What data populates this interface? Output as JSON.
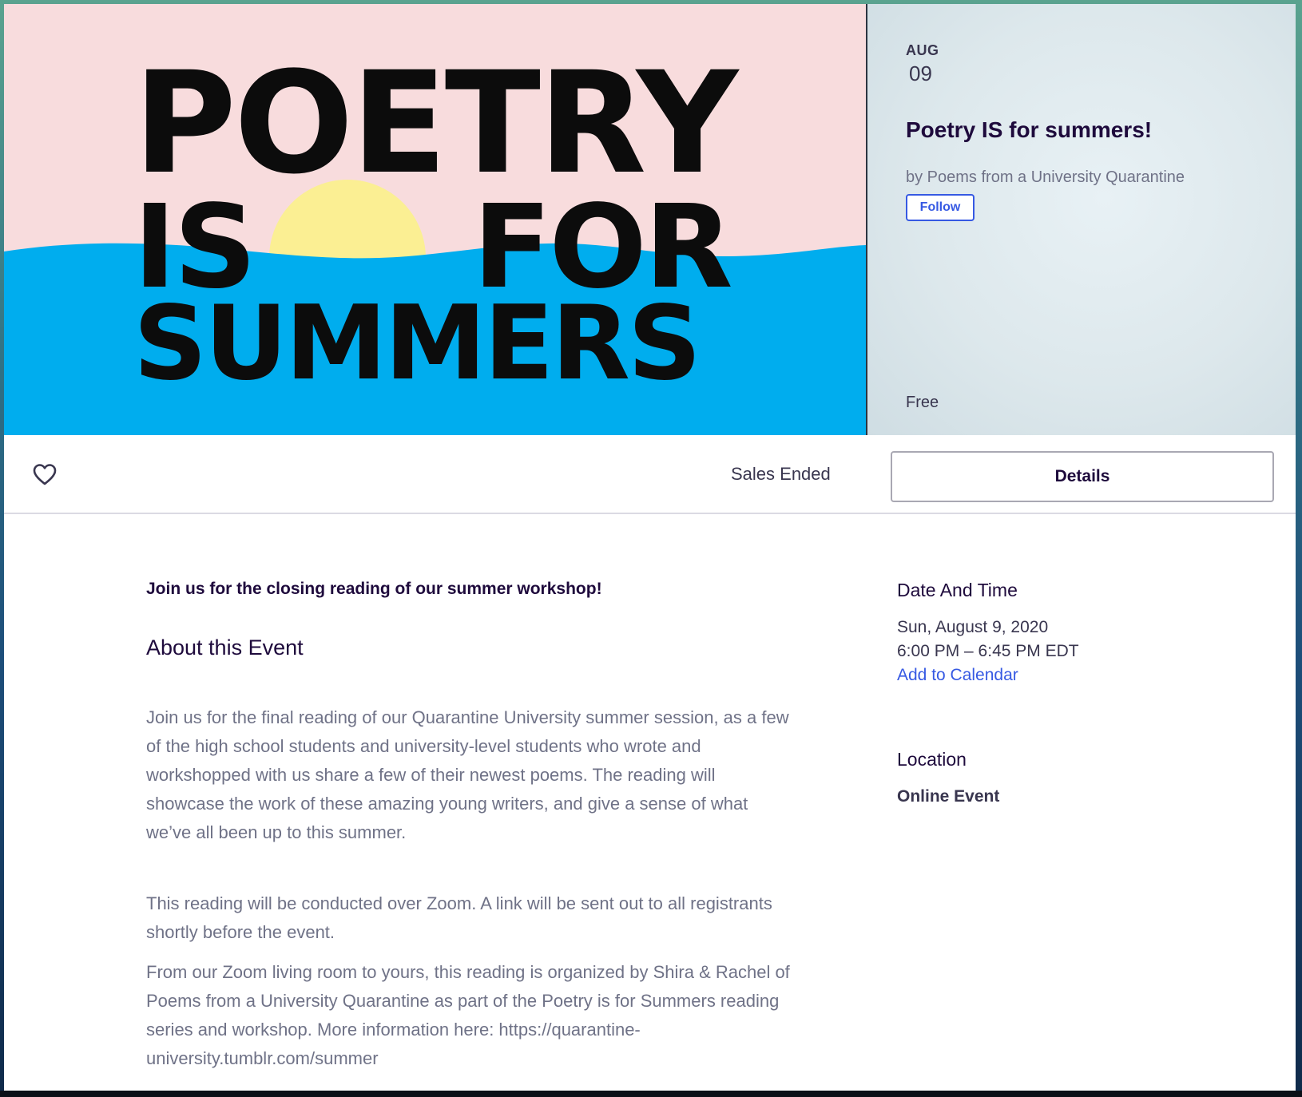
{
  "hero": {
    "poster": {
      "line1": "POETRY",
      "line2_left": "IS",
      "line2_right": "FOR",
      "line3": "SUMMERS",
      "colors": {
        "sky": "#f8dcdd",
        "sun": "#fbef93",
        "sea": "#00adee",
        "text": "#0c0c0c"
      }
    },
    "date_month": "AUG",
    "date_day": "09",
    "title": "Poetry IS for summers!",
    "organizer": "by Poems from a University Quarantine",
    "follow_label": "Follow",
    "price": "Free"
  },
  "action_bar": {
    "favorite_icon": "heart-icon",
    "sales_status": "Sales Ended",
    "details_label": "Details"
  },
  "main": {
    "summary": "Join us for the closing reading of our summer workshop!",
    "about_heading": "About this Event",
    "paragraphs": [
      "Join us for the final reading of our Quarantine University summer session, as a few of the high school students and university-level students who wrote and workshopped with us share a few of their newest poems. The reading will showcase the work of these amazing young writers, and give a sense of what we’ve all been up to this summer.",
      "This reading will be conducted over Zoom. A link will be sent out to all registrants shortly before the event.",
      "From our Zoom living room to yours, this reading is organized by Shira & Rachel of Poems from a University Quarantine as part of the Poetry is for Summers reading series and workshop. More information here: https://quarantine-university.tumblr.com/summer"
    ]
  },
  "sidebar": {
    "date_heading": "Date And Time",
    "date_line": "Sun, August 9, 2020",
    "time_line": "6:00 PM – 6:45 PM EDT",
    "add_to_calendar": "Add to Calendar",
    "location_heading": "Location",
    "location_value": "Online Event"
  },
  "colors": {
    "accent_blue": "#3659e3",
    "heading": "#1e0a3c",
    "body_text": "#6f7287"
  }
}
